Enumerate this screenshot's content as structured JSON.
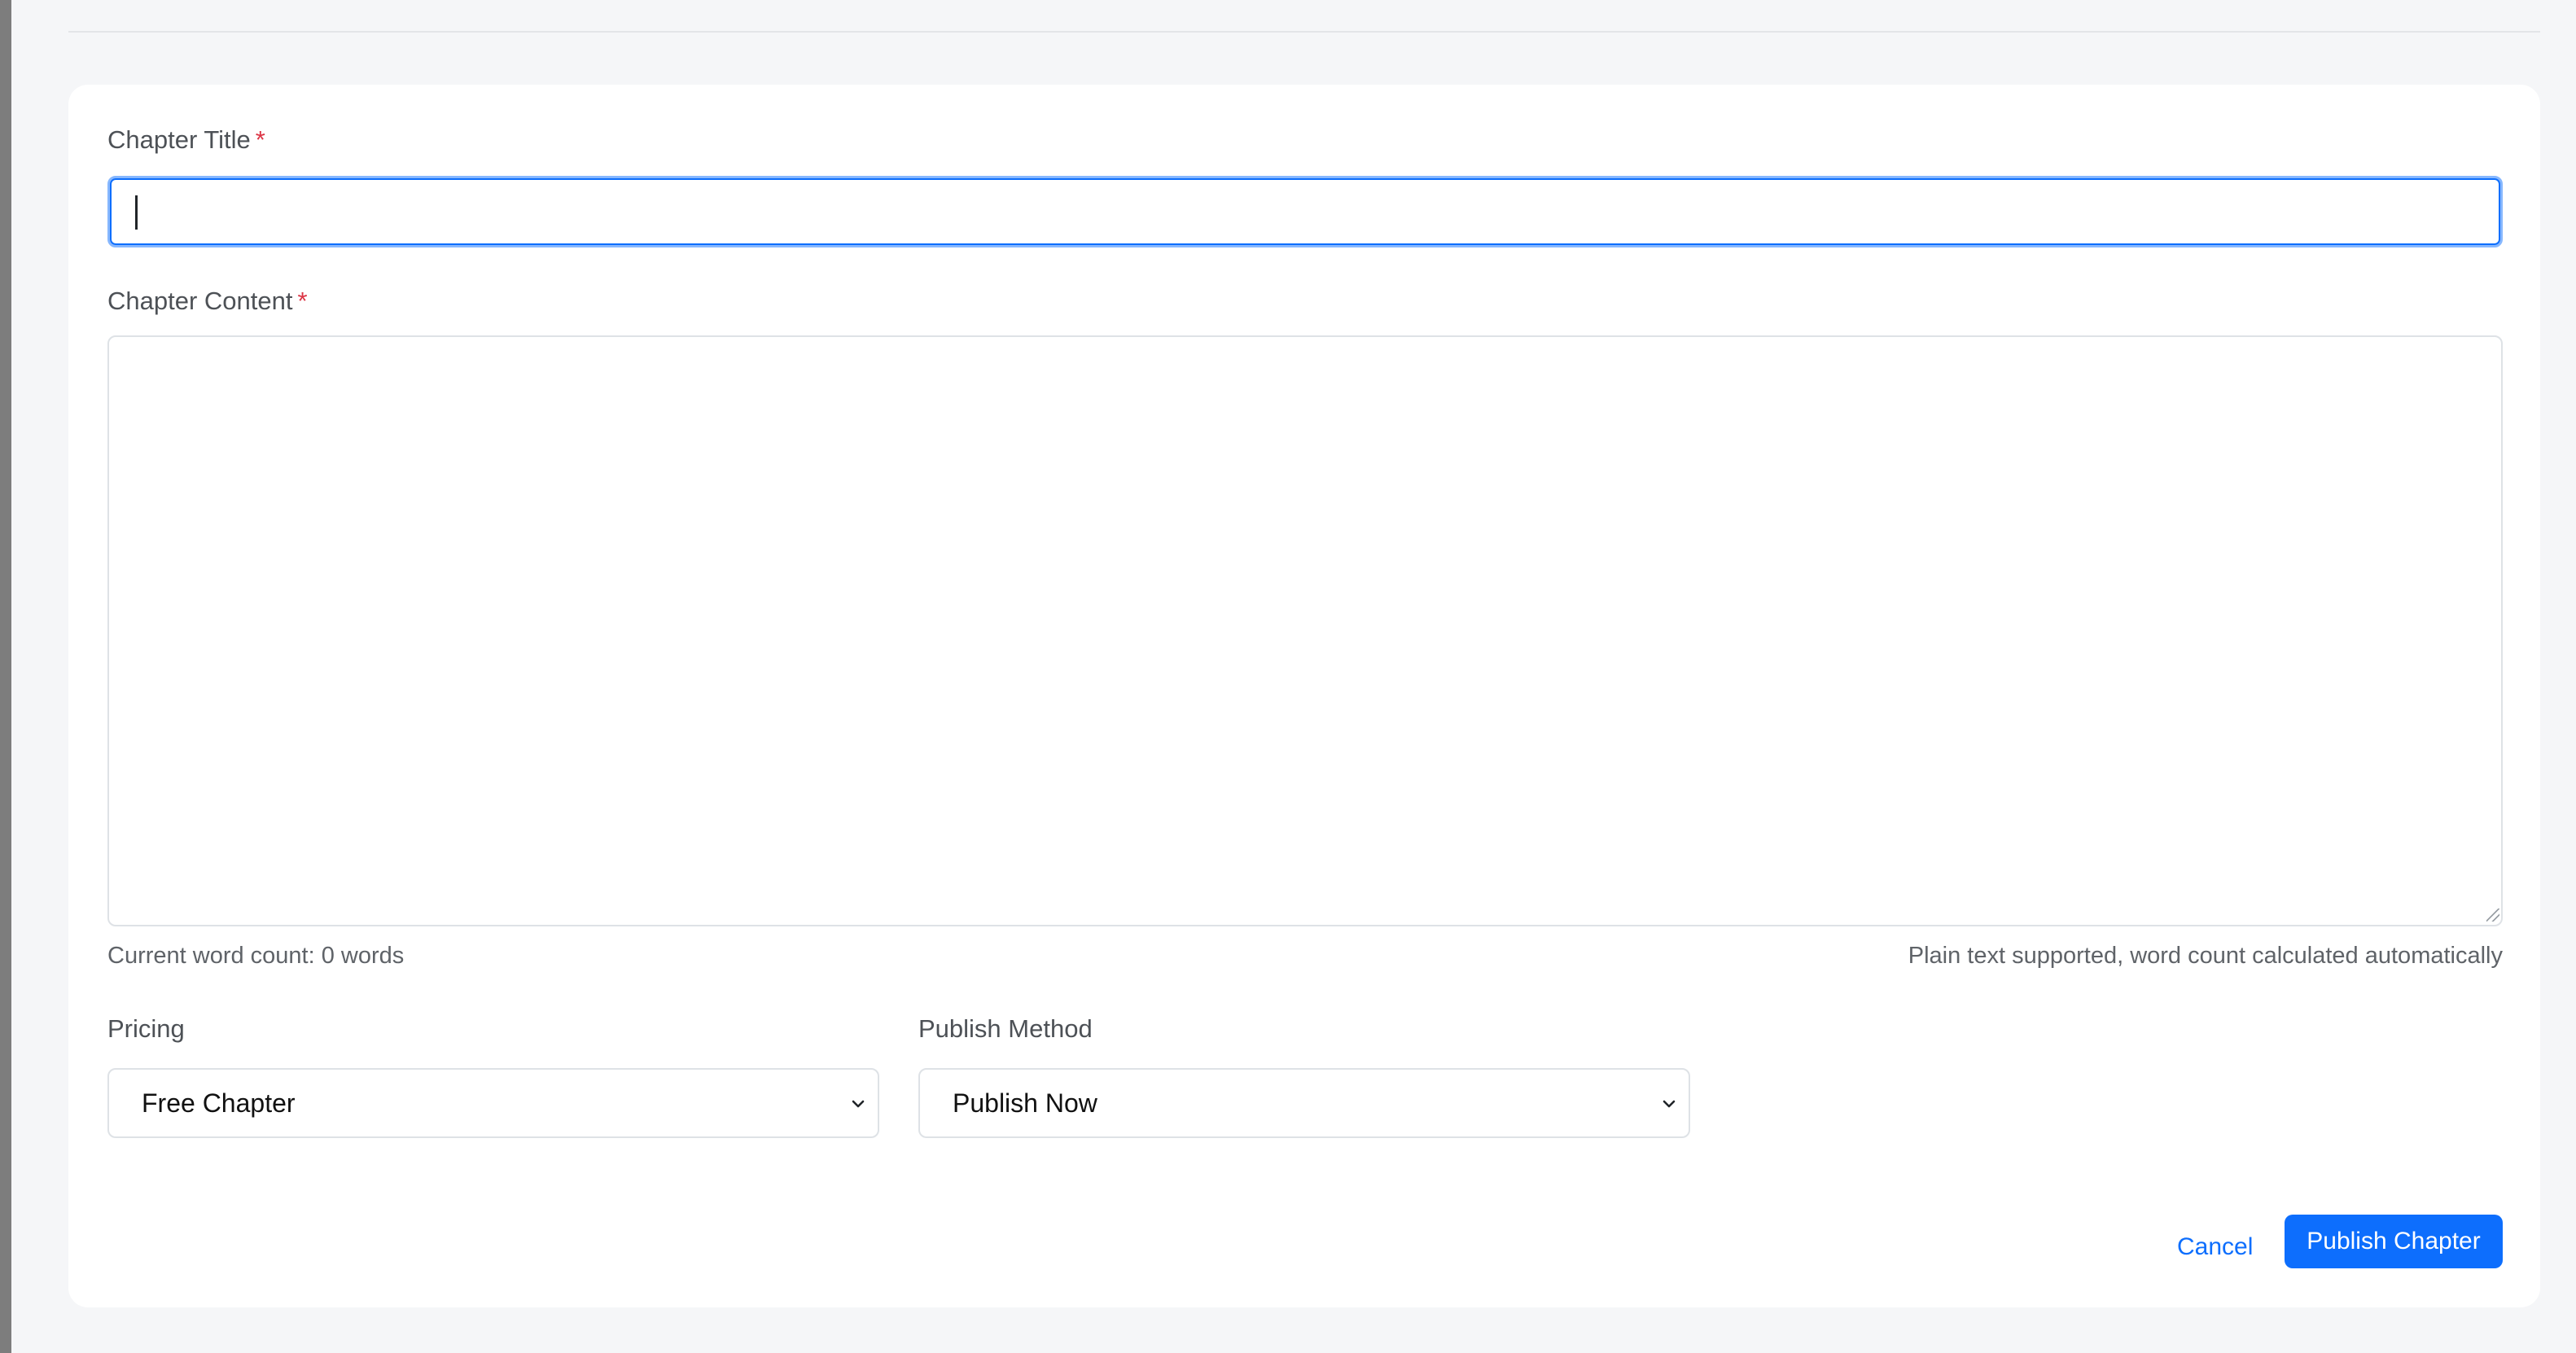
{
  "form": {
    "title_field": {
      "label": "Chapter Title",
      "required_mark": "*",
      "value": ""
    },
    "content_field": {
      "label": "Chapter Content",
      "required_mark": "*",
      "value": ""
    },
    "word_count_text": "Current word count: 0 words",
    "content_hint": "Plain text supported, word count calculated automatically",
    "pricing": {
      "label": "Pricing",
      "selected": "Free Chapter"
    },
    "publish_method": {
      "label": "Publish Method",
      "selected": "Publish Now"
    },
    "actions": {
      "cancel_label": "Cancel",
      "publish_label": "Publish Chapter"
    }
  },
  "colors": {
    "accent": "#0d6efd",
    "required": "#dc3545",
    "page_background": "#f5f6f8",
    "card_background": "#ffffff"
  },
  "icons": {
    "select_indicator": "chevron-down-icon",
    "textarea_resize": "resize-grip-icon"
  }
}
